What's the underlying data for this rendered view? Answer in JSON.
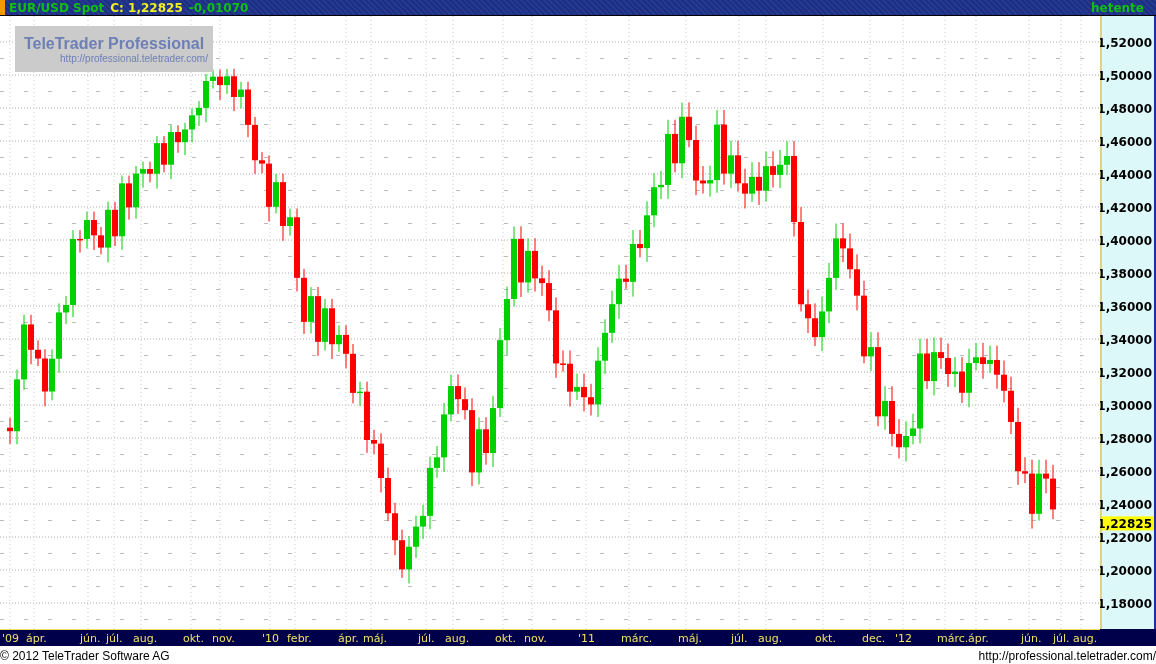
{
  "title_bar": {
    "symbol": "EUR/USD Spot",
    "close_label": "C: 1,22825",
    "change": "-0,01070",
    "period": "hetente"
  },
  "logo": {
    "name": "TeleTrader Professional",
    "url": "http://professional.teletrader.com/"
  },
  "y_axis": {
    "labels": [
      "1,52000",
      "1,50000",
      "1,48000",
      "1,46000",
      "1,44000",
      "1,42000",
      "1,40000",
      "1,38000",
      "1,36000",
      "1,34000",
      "1,32000",
      "1,30000",
      "1,28000",
      "1,26000",
      "1,24000",
      "1,22000",
      "1,20000",
      "1,18000"
    ],
    "current_price": "1,22825"
  },
  "x_axis": {
    "labels": [
      "'09",
      "ápr.",
      "jún.",
      "júl.",
      "aug.",
      "okt.",
      "nov.",
      "'10",
      "febr.",
      "ápr.",
      "máj.",
      "júl.",
      "aug.",
      "okt.",
      "nov.",
      "'11",
      "márc.",
      "máj.",
      "júl.",
      "aug.",
      "okt.",
      "dec.",
      "'12",
      "márc.",
      "ápr.",
      "jún.",
      "júl.",
      "aug."
    ]
  },
  "footer": {
    "copyright": "© 2012 TeleTrader Software AG",
    "url": "http://professional.teletrader.com/"
  }
}
